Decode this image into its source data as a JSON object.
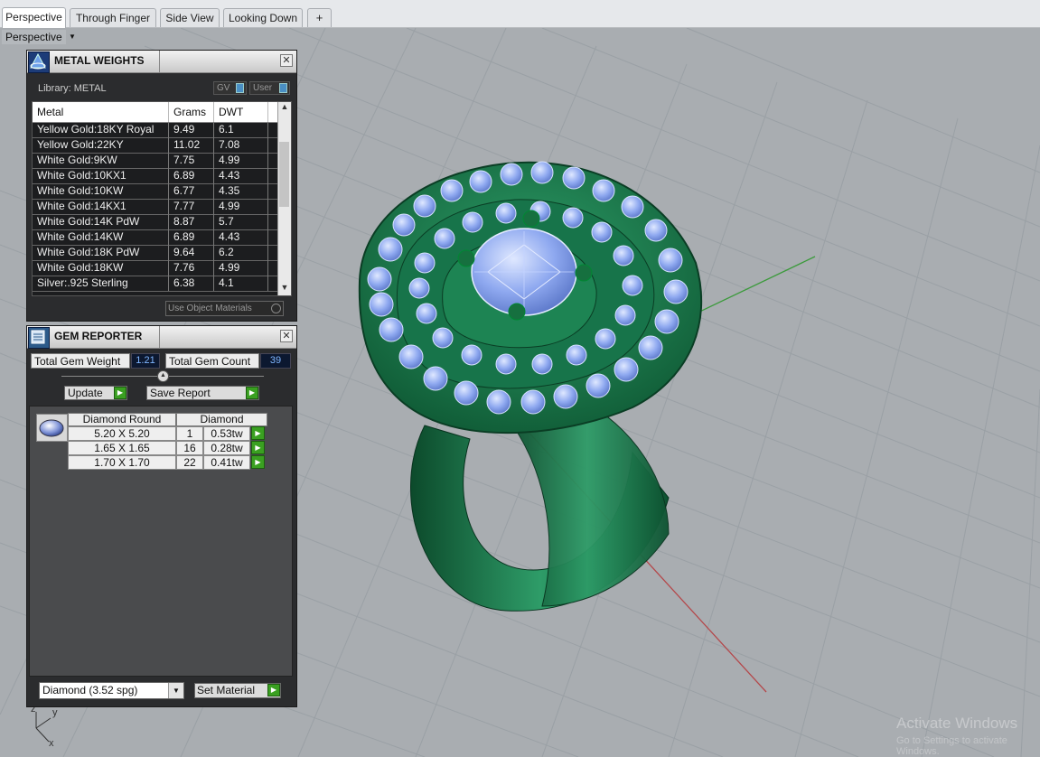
{
  "tabs": [
    {
      "label": "Perspective",
      "active": true
    },
    {
      "label": "Through Finger",
      "active": false
    },
    {
      "label": "Side View",
      "active": false
    },
    {
      "label": "Looking Down",
      "active": false
    }
  ],
  "viewport": {
    "label": "Perspective",
    "axes": {
      "x": "x",
      "y": "y",
      "z": "z"
    },
    "watermark": "Activate Windows",
    "watermark_sub": "Go to Settings to activate Windows."
  },
  "metal_weights": {
    "title": "METAL WEIGHTS",
    "library_label": "Library: METAL",
    "toggle_gv": "GV",
    "toggle_user": "User",
    "columns": [
      "Metal",
      "Grams",
      "DWT"
    ],
    "rows": [
      {
        "metal": "Yellow Gold:18KY Royal",
        "grams": "9.49",
        "dwt": "6.1"
      },
      {
        "metal": "Yellow Gold:22KY",
        "grams": "11.02",
        "dwt": "7.08"
      },
      {
        "metal": "White Gold:9KW",
        "grams": "7.75",
        "dwt": "4.99"
      },
      {
        "metal": "White Gold:10KX1",
        "grams": "6.89",
        "dwt": "4.43"
      },
      {
        "metal": "White Gold:10KW",
        "grams": "6.77",
        "dwt": "4.35"
      },
      {
        "metal": "White Gold:14KX1",
        "grams": "7.77",
        "dwt": "4.99"
      },
      {
        "metal": "White Gold:14K PdW",
        "grams": "8.87",
        "dwt": "5.7"
      },
      {
        "metal": "White Gold:14KW",
        "grams": "6.89",
        "dwt": "4.43"
      },
      {
        "metal": "White Gold:18K PdW",
        "grams": "9.64",
        "dwt": "6.2"
      },
      {
        "metal": "White Gold:18KW",
        "grams": "7.76",
        "dwt": "4.99"
      },
      {
        "metal": "Silver:.925 Sterling",
        "grams": "6.38",
        "dwt": "4.1"
      }
    ],
    "use_object_materials": "Use Object Materials"
  },
  "gem_reporter": {
    "title": "GEM REPORTER",
    "total_weight_label": "Total Gem Weight",
    "total_weight_value": "1.21",
    "total_count_label": "Total Gem Count",
    "total_count_value": "39",
    "update_label": "Update",
    "save_report_label": "Save Report",
    "header_shape": "Diamond Round",
    "header_material": "Diamond",
    "gems": [
      {
        "size": "5.20 X 5.20",
        "count": "1",
        "weight": "0.53tw"
      },
      {
        "size": "1.65 X 1.65",
        "count": "16",
        "weight": "0.28tw"
      },
      {
        "size": "1.70 X 1.70",
        "count": "22",
        "weight": "0.41tw"
      }
    ],
    "material_select": "Diamond     (3.52 spg)",
    "set_material_label": "Set Material"
  },
  "colors": {
    "ring_green": "#1f8a55",
    "gem_blue": "#8aaaf0",
    "viewport_bg": "#a9adb1",
    "grid_line": "#9ca1a6",
    "axis_red": "#b4474a",
    "axis_green": "#3a9a3a"
  }
}
